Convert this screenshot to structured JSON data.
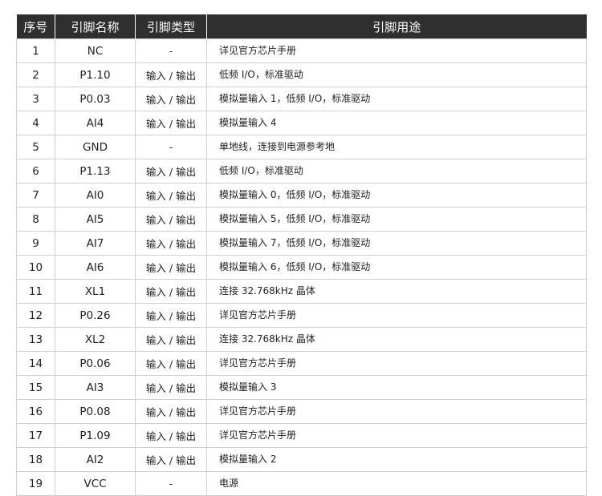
{
  "table": {
    "headers": [
      "序号",
      "引脚名称",
      "引脚类型",
      "引脚用途"
    ],
    "rows": [
      [
        "1",
        "NC",
        "-",
        "详见官方芯片手册"
      ],
      [
        "2",
        "P1.10",
        "输入 / 输出",
        "低频 I/O，标准驱动"
      ],
      [
        "3",
        "P0.03",
        "输入 / 输出",
        "模拟量输入 1，低频 I/O，标准驱动"
      ],
      [
        "4",
        "AI4",
        "输入 / 输出",
        "模拟量输入 4"
      ],
      [
        "5",
        "GND",
        "-",
        "单地线，连接到电源参考地"
      ],
      [
        "6",
        "P1.13",
        "输入 / 输出",
        "低频 I/O，标准驱动"
      ],
      [
        "7",
        "AI0",
        "输入 / 输出",
        "模拟量输入 0，低频 I/O，标准驱动"
      ],
      [
        "8",
        "AI5",
        "输入 / 输出",
        "模拟量输入 5，低频 I/O，标准驱动"
      ],
      [
        "9",
        "AI7",
        "输入 / 输出",
        "模拟量输入 7，低频 I/O，标准驱动"
      ],
      [
        "10",
        "AI6",
        "输入 / 输出",
        "模拟量输入 6，低频 I/O，标准驱动"
      ],
      [
        "11",
        "XL1",
        "输入 / 输出",
        "连接 32.768kHz 晶体"
      ],
      [
        "12",
        "P0.26",
        "输入 / 输出",
        "详见官方芯片手册"
      ],
      [
        "13",
        "XL2",
        "输入 / 输出",
        "连接 32.768kHz 晶体"
      ],
      [
        "14",
        "P0.06",
        "输入 / 输出",
        "详见官方芯片手册"
      ],
      [
        "15",
        "AI3",
        "输入 / 输出",
        "模拟量输入 3"
      ],
      [
        "16",
        "P0.08",
        "输入 / 输出",
        "详见官方芯片手册"
      ],
      [
        "17",
        "P1.09",
        "输入 / 输出",
        "详见官方芯片手册"
      ],
      [
        "18",
        "AI2",
        "输入 / 输出",
        "模拟量输入 2"
      ],
      [
        "19",
        "VCC",
        "-",
        "电源"
      ]
    ]
  }
}
